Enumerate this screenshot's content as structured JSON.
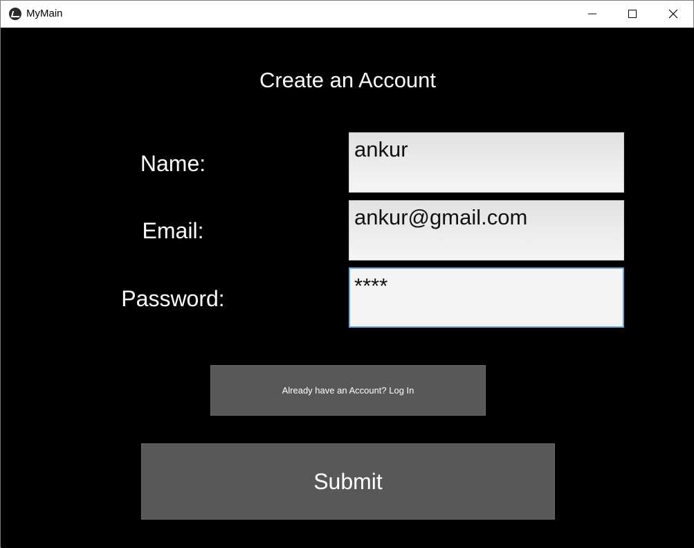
{
  "window": {
    "title": "MyMain"
  },
  "form": {
    "heading": "Create an Account",
    "name_label": "Name:",
    "name_value": "ankur",
    "email_label": "Email:",
    "email_value": "ankur@gmail.com",
    "password_label": "Password:",
    "password_value": "****",
    "login_button": "Already have an Account? Log In",
    "submit_button": "Submit"
  }
}
